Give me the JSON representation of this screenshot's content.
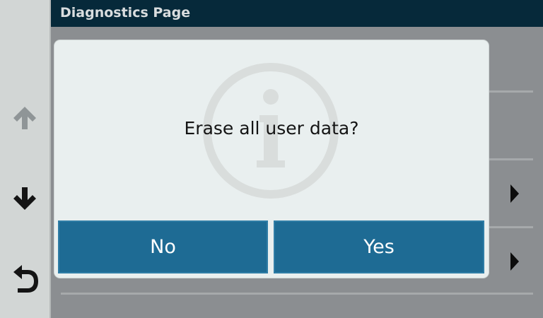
{
  "header": {
    "title": "Diagnostics Page"
  },
  "rail": {
    "up_icon": "arrow-up-icon",
    "down_icon": "arrow-down-icon",
    "back_icon": "back-arrow-icon"
  },
  "dialog": {
    "icon": "info-icon",
    "message": "Erase all user data?",
    "no_label": "No",
    "yes_label": "Yes"
  },
  "colors": {
    "header_bg": "#06293a",
    "button_bg": "#1e6b94",
    "dialog_bg": "#e9efef"
  }
}
